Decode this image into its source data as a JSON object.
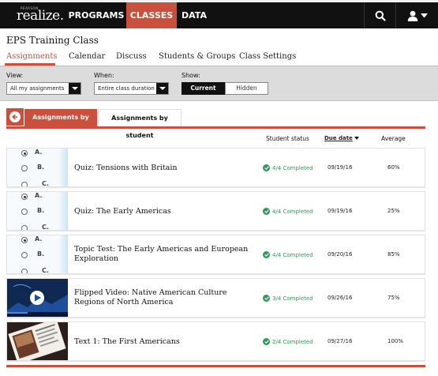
{
  "brand": {
    "top": "PEARSON",
    "name": "realize."
  },
  "nav": {
    "programs": "PROGRAMS",
    "classes": "CLASSES",
    "data": "DATA"
  },
  "icons": {
    "search": "search-icon",
    "user": "user-icon",
    "user_menu": "chevron-down-icon"
  },
  "class_name": "EPS Training Class",
  "subtabs": [
    "Assignments",
    "Calendar",
    "Discuss",
    "Students & Groups",
    "Class Settings"
  ],
  "filters": {
    "view_label": "View:",
    "view_value": "All my assignments",
    "when_label": "When:",
    "when_value": "Entire class duration",
    "show_label": "Show:",
    "show_current": "Current",
    "show_hidden": "Hidden"
  },
  "view_tabs": {
    "by_class": "Assignments by class",
    "by_student": "Assignments by student"
  },
  "columns": {
    "status": "Student status",
    "due": "Due date",
    "average": "Average"
  },
  "quiz_options": [
    "A.",
    "B.",
    "C."
  ],
  "assignments": [
    {
      "title": "Quiz: Tensions with Britain",
      "status": "4/4 Completed",
      "due": "09/19/16",
      "average": "60%"
    },
    {
      "title": "Quiz: The Early Americas",
      "status": "4/4 Completed",
      "due": "09/19/16",
      "average": "25%"
    },
    {
      "title_line1": "Topic Test: The Early Americas and European",
      "title_line2": "Exploration",
      "status": "4/4 Completed",
      "due": "09/20/16",
      "average": "85%"
    },
    {
      "title_line1": "Flipped Video: Native American Culture",
      "title_line2": "Regions of North America",
      "status": "3/4 Completed",
      "due": "09/26/16",
      "average": "75%"
    },
    {
      "title": "Text 1: The First Americans",
      "status": "2/4 Completed",
      "due": "09/27/16",
      "average": "100%"
    }
  ],
  "colors": {
    "accent": "#c8503c",
    "topbar": "#111111",
    "complete": "#2e9a5a"
  }
}
